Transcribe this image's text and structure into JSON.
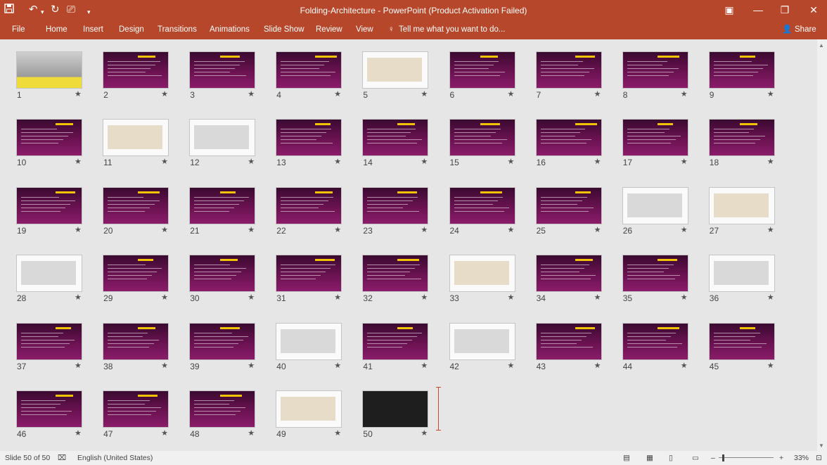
{
  "window": {
    "title": "Folding-Architecture - PowerPoint (Product Activation Failed)"
  },
  "ribbon": {
    "file": "File",
    "tabs": [
      "Home",
      "Insert",
      "Design",
      "Transitions",
      "Animations",
      "Slide Show",
      "Review",
      "View"
    ],
    "tellme": "Tell me what you want to do...",
    "share": "Share"
  },
  "slides": [
    {
      "n": "1",
      "theme": "image"
    },
    {
      "n": "2",
      "theme": "dark"
    },
    {
      "n": "3",
      "theme": "dark"
    },
    {
      "n": "4",
      "theme": "dark"
    },
    {
      "n": "5",
      "theme": "light"
    },
    {
      "n": "6",
      "theme": "dark"
    },
    {
      "n": "7",
      "theme": "dark"
    },
    {
      "n": "8",
      "theme": "dark"
    },
    {
      "n": "9",
      "theme": "dark"
    },
    {
      "n": "10",
      "theme": "dark"
    },
    {
      "n": "11",
      "theme": "light"
    },
    {
      "n": "12",
      "theme": "light"
    },
    {
      "n": "13",
      "theme": "dark"
    },
    {
      "n": "14",
      "theme": "dark"
    },
    {
      "n": "15",
      "theme": "dark"
    },
    {
      "n": "16",
      "theme": "dark"
    },
    {
      "n": "17",
      "theme": "dark"
    },
    {
      "n": "18",
      "theme": "dark"
    },
    {
      "n": "19",
      "theme": "dark"
    },
    {
      "n": "20",
      "theme": "dark"
    },
    {
      "n": "21",
      "theme": "dark"
    },
    {
      "n": "22",
      "theme": "dark"
    },
    {
      "n": "23",
      "theme": "dark"
    },
    {
      "n": "24",
      "theme": "dark"
    },
    {
      "n": "25",
      "theme": "dark"
    },
    {
      "n": "26",
      "theme": "light"
    },
    {
      "n": "27",
      "theme": "light"
    },
    {
      "n": "28",
      "theme": "light"
    },
    {
      "n": "29",
      "theme": "dark"
    },
    {
      "n": "30",
      "theme": "dark"
    },
    {
      "n": "31",
      "theme": "dark"
    },
    {
      "n": "32",
      "theme": "dark"
    },
    {
      "n": "33",
      "theme": "light"
    },
    {
      "n": "34",
      "theme": "dark"
    },
    {
      "n": "35",
      "theme": "dark"
    },
    {
      "n": "36",
      "theme": "light"
    },
    {
      "n": "37",
      "theme": "dark"
    },
    {
      "n": "38",
      "theme": "dark"
    },
    {
      "n": "39",
      "theme": "dark"
    },
    {
      "n": "40",
      "theme": "light"
    },
    {
      "n": "41",
      "theme": "dark"
    },
    {
      "n": "42",
      "theme": "light"
    },
    {
      "n": "43",
      "theme": "dark"
    },
    {
      "n": "44",
      "theme": "dark"
    },
    {
      "n": "45",
      "theme": "dark"
    },
    {
      "n": "46",
      "theme": "dark"
    },
    {
      "n": "47",
      "theme": "dark"
    },
    {
      "n": "48",
      "theme": "dark"
    },
    {
      "n": "49",
      "theme": "light"
    },
    {
      "n": "50",
      "theme": "darkgray"
    }
  ],
  "status": {
    "slide_counter": "Slide 50 of 50",
    "language": "English (United States)",
    "zoom": "33%",
    "zoom_minus": "–",
    "zoom_plus": "+"
  },
  "icons": {
    "save": "save-icon",
    "undo": "undo-icon",
    "redo": "redo-icon",
    "star": "animation-star-icon"
  },
  "colors": {
    "ribbon": "#b7472a",
    "slide_theme": "#6b1251",
    "accent": "#f2c300"
  }
}
